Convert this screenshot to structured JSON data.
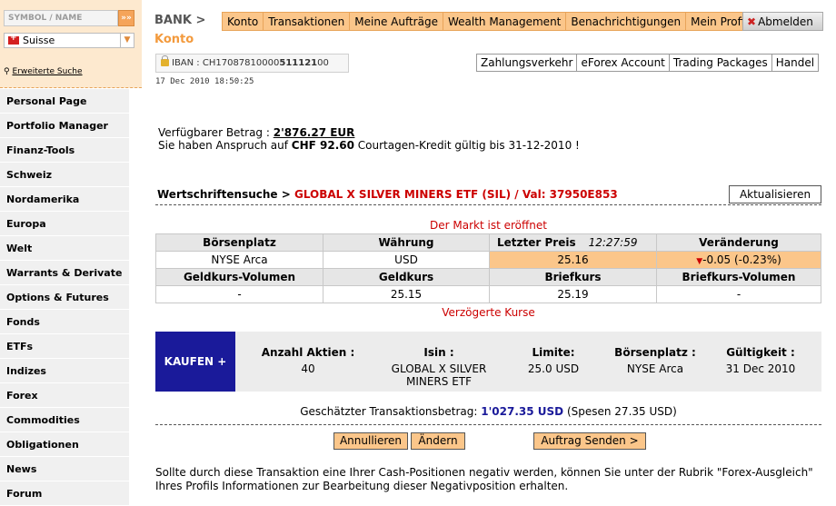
{
  "sidebar": {
    "symbol_placeholder": "SYMBOL / NAME",
    "go_label": "»»",
    "country": "Suisse",
    "advanced_search": "Erweiterte Suche",
    "items": [
      "Personal Page",
      "Portfolio Manager",
      "Finanz-Tools",
      "Schweiz",
      "Nordamerika",
      "Europa",
      "Welt",
      "Warrants & Derivate",
      "Options & Futures",
      "Fonds",
      "ETFs",
      "Indizes",
      "Forex",
      "Commodities",
      "Obligationen",
      "News",
      "Forum"
    ]
  },
  "header": {
    "bank": "BANK >",
    "section": "Konto",
    "tabs": [
      "Konto",
      "Transaktionen",
      "Meine Aufträge",
      "Wealth Management",
      "Benachrichtigungen",
      "Mein Profil"
    ],
    "logout": "Abmelden",
    "iban_label": "IBAN : CH17087810000",
    "iban_bold": "511121",
    "iban_end": "00",
    "subtabs": [
      "Zahlungsverkehr",
      "eForex Account",
      "Trading Packages",
      "Handel"
    ],
    "timestamp": "17 Dec 2010 18:50:25"
  },
  "account": {
    "available_label": "Verfügbarer Betrag : ",
    "available_amount": "2'876.27 EUR",
    "credit_prefix": "Sie haben Anspruch auf ",
    "credit_amount": "CHF 92.60",
    "credit_suffix": " Courtagen-Kredit gültig bis 31-12-2010 !"
  },
  "search": {
    "label": "Wertschriftensuche > ",
    "security": "GLOBAL X SILVER MINERS ETF (SIL)",
    "valor": "  / Val: 37950E853",
    "refresh": "Aktualisieren"
  },
  "quote": {
    "market_status": "Der Markt ist eröffnet",
    "headers": [
      "Börsenplatz",
      "Währung",
      "Letzter Preis",
      "Veränderung"
    ],
    "last_time": "12:27:59",
    "exchange": "NYSE Arca",
    "currency": "USD",
    "last_price": "25.16",
    "change": "-0.05 (-0.23%)",
    "headers2": [
      "Geldkurs-Volumen",
      "Geldkurs",
      "Briefkurs",
      "Briefkurs-Volumen"
    ],
    "bid_volume": "-",
    "bid": "25.15",
    "ask": "25.19",
    "ask_volume": "-",
    "delayed": "Verzögerte Kurse"
  },
  "order": {
    "action": "KAUFEN +",
    "qty_label": "Anzahl Aktien :",
    "qty": "40",
    "isin_label": "Isin :",
    "isin_line1": "GLOBAL X SILVER",
    "isin_line2": "MINERS ETF",
    "limit_label": "Limite:",
    "limit": "25.0  USD",
    "exchange_label": "Börsenplatz :",
    "exchange": "NYSE Arca",
    "validity_label": "Gültigkeit :",
    "validity": "31 Dec 2010",
    "estimate_label": "Geschätzter Transaktionsbetrag: ",
    "estimate_amount": "1'027.35 USD",
    "estimate_fees": " (Spesen 27.35 USD)",
    "cancel": "Annullieren",
    "modify": "Ändern",
    "send": "Auftrag Senden >"
  },
  "note": "Sollte durch diese Transaktion eine Ihrer Cash-Positionen negativ werden, können Sie unter der Rubrik \"Forex-Ausgleich\" Ihres Profils Informationen zur Bearbeitung dieser Negativposition erhalten.",
  "colors": {
    "accent": "#fbc68a",
    "brand_blue": "#1a1a9a",
    "alert": "#cc0000"
  }
}
